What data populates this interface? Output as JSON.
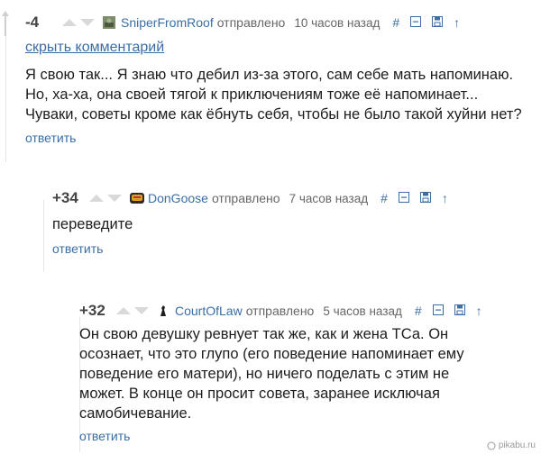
{
  "comments": [
    {
      "score": "-4",
      "username": "SniperFromRoof",
      "sent_label": "отправлено",
      "time": "10 часов назад",
      "hide_label": "скрыть комментарий",
      "lines": [
        "Я свою так... Я знаю что дебил из-за этого, сам себе мать напоминаю.",
        "Но, ха-ха, она своей тягой к приключениям тоже её напоминает...",
        "Чуваки, советы кроме как ёбнуть себя, чтобы не было такой хуйни нет?"
      ],
      "reply_label": "ответить"
    },
    {
      "score": "+34",
      "username": "DonGoose",
      "sent_label": "отправлено",
      "time": "7 часов назад",
      "lines": [
        "переведите"
      ],
      "reply_label": "ответить"
    },
    {
      "score": "+32",
      "username": "CourtOfLaw",
      "sent_label": "отправлено",
      "time": "5 часов назад",
      "lines": [
        "Он свою девушку ревнует так же, как и жена ТСа. Он",
        "осознает, что это глупо (его поведение напоминает ему",
        "поведение его матери), но ничего поделать с этим не",
        "может. В конце он просит совета, заранее исключая",
        "самобичевание."
      ],
      "reply_label": "ответить"
    }
  ],
  "tools": {
    "permalink": "#",
    "collapse": "⊟",
    "save": "🖫",
    "parent": "↑"
  },
  "watermark": "pikabu.ru",
  "colors": {
    "link": "#3a6ea5",
    "text": "#1d1d1d",
    "meta": "#666666"
  }
}
